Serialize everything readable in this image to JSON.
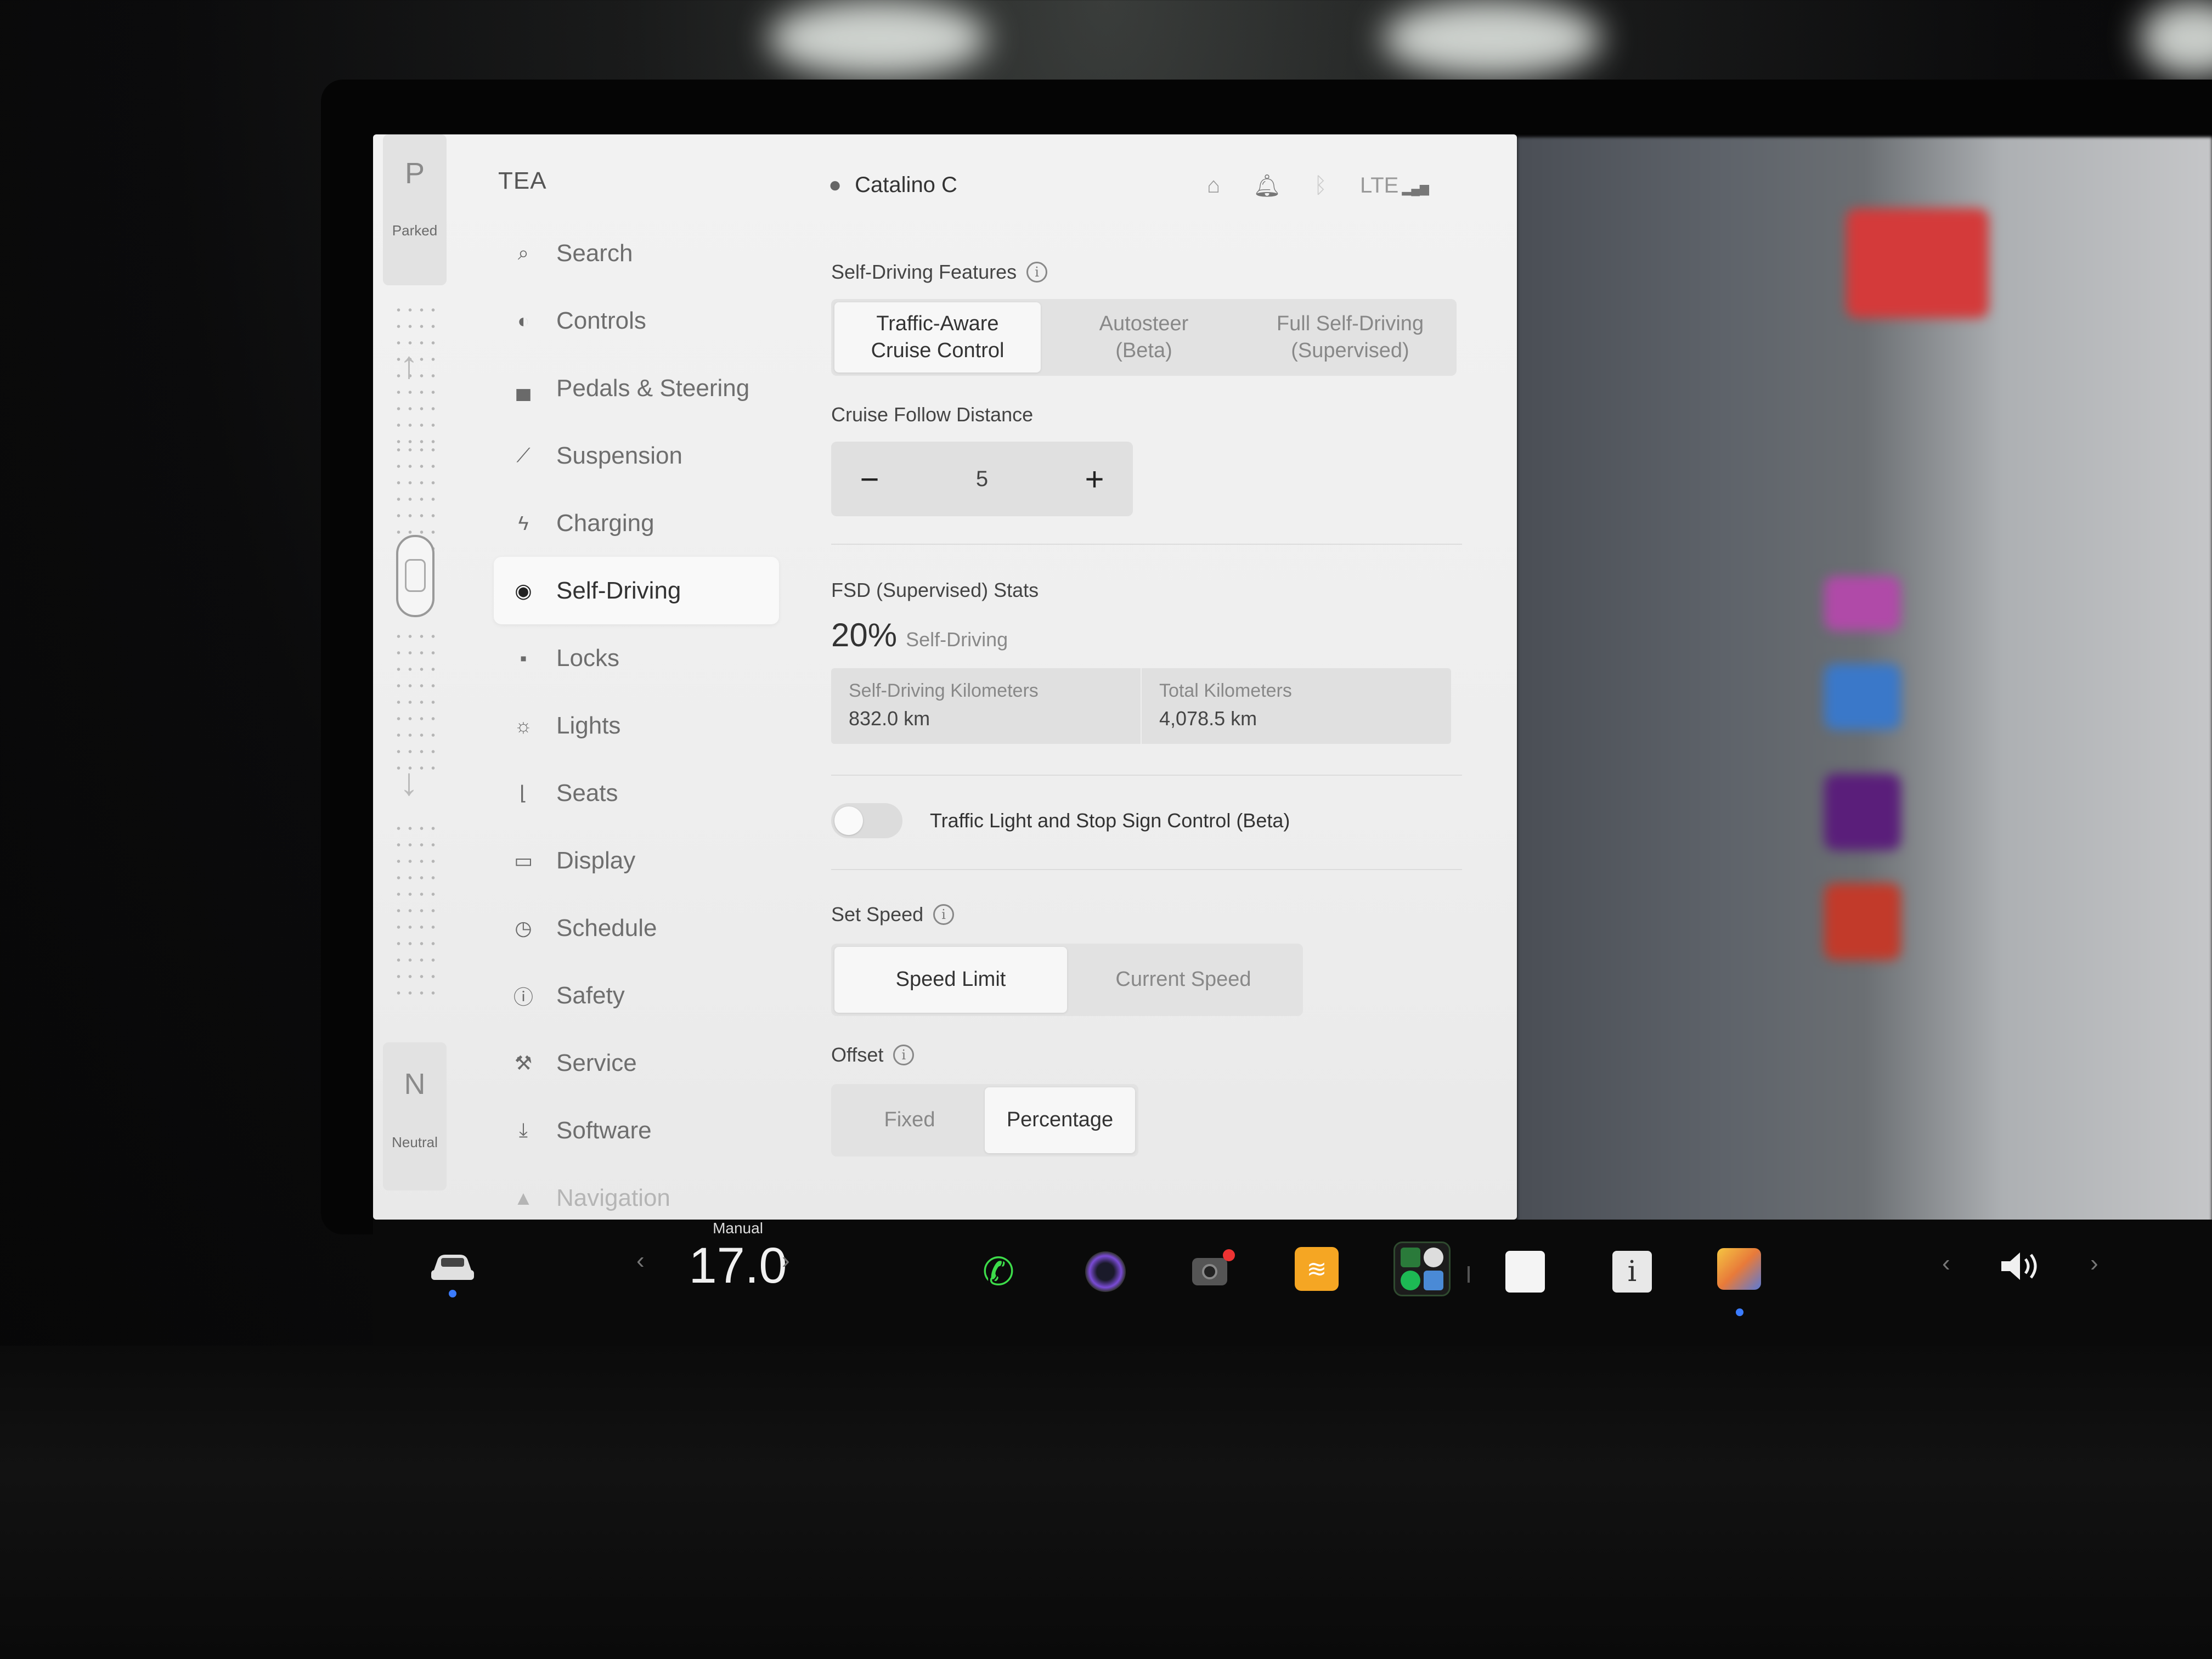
{
  "gear": {
    "top_letter": "P",
    "top_label": "Parked",
    "bottom_letter": "N",
    "bottom_label": "Neutral"
  },
  "menu": {
    "title": "TEA",
    "items": [
      {
        "label": "Search",
        "icon": "search-icon"
      },
      {
        "label": "Controls",
        "icon": "toggle-icon"
      },
      {
        "label": "Pedals & Steering",
        "icon": "car-icon"
      },
      {
        "label": "Suspension",
        "icon": "wrench-icon"
      },
      {
        "label": "Charging",
        "icon": "bolt-icon"
      },
      {
        "label": "Self-Driving",
        "icon": "steering-wheel-icon"
      },
      {
        "label": "Locks",
        "icon": "lock-icon"
      },
      {
        "label": "Lights",
        "icon": "sun-icon"
      },
      {
        "label": "Seats",
        "icon": "seat-icon"
      },
      {
        "label": "Display",
        "icon": "display-icon"
      },
      {
        "label": "Schedule",
        "icon": "clock-icon"
      },
      {
        "label": "Safety",
        "icon": "alert-icon"
      },
      {
        "label": "Service",
        "icon": "service-icon"
      },
      {
        "label": "Software",
        "icon": "download-icon"
      },
      {
        "label": "Navigation",
        "icon": "navigation-icon"
      }
    ]
  },
  "topbar": {
    "user_name": "Catalino C",
    "signal_label": "LTE"
  },
  "self_driving": {
    "features_title": "Self-Driving Features",
    "features": [
      {
        "line1": "Traffic-Aware",
        "line2": "Cruise Control"
      },
      {
        "line1": "Autosteer",
        "line2": "(Beta)"
      },
      {
        "line1": "Full Self-Driving",
        "line2": "(Supervised)"
      }
    ],
    "follow_title": "Cruise Follow Distance",
    "follow_minus": "−",
    "follow_value": "5",
    "follow_plus": "+",
    "stats_title": "FSD (Supervised) Stats",
    "stats_pct": "20%",
    "stats_pct_label": "Self-Driving",
    "stats": [
      {
        "key": "Self-Driving Kilometers",
        "value": "832.0 km"
      },
      {
        "key": "Total Kilometers",
        "value": "4,078.5 km"
      }
    ],
    "toggle_label": "Traffic Light and Stop Sign Control (Beta)",
    "toggle_on": false,
    "speed_title": "Set Speed",
    "speed_options": [
      "Speed Limit",
      "Current Speed"
    ],
    "offset_title": "Offset",
    "offset_options": [
      "Fixed",
      "Percentage"
    ]
  },
  "taskbar": {
    "temp_mode": "Manual",
    "temp_value": "17.0",
    "chev_left": "‹",
    "chev_right": "›"
  },
  "colors": {
    "accent_blue": "#3b7cff",
    "phone_green": "#3ddc4a",
    "audible_orange": "#f5a623"
  }
}
